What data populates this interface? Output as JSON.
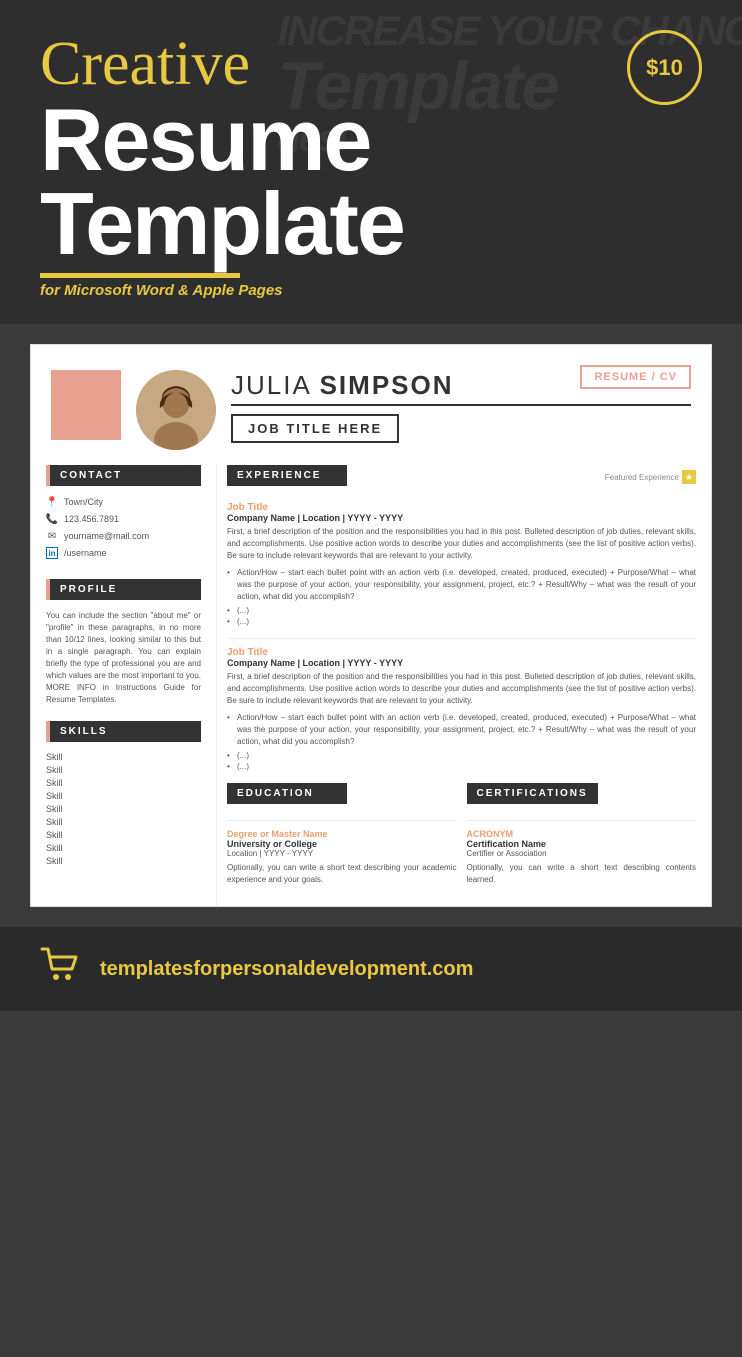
{
  "banner": {
    "creative_label": "Creative",
    "resume_label": "Resume",
    "template_label": "Template",
    "subtitle": "for Microsoft Word & Apple Pages",
    "price": "$10",
    "watermark": [
      "INCREASE YOUR CHANC",
      "Template",
      "desi"
    ]
  },
  "resume_cv_label": "RESUME / CV",
  "header": {
    "name_first": "JULIA ",
    "name_last": "SIMPSON",
    "job_title": "JOB TITLE HERE"
  },
  "contact": {
    "section_label": "CONTACT",
    "items": [
      {
        "icon": "📍",
        "text": "Town/City"
      },
      {
        "icon": "📞",
        "text": "123.456.7891"
      },
      {
        "icon": "✉",
        "text": "yourname@mail.com"
      },
      {
        "icon": "in",
        "text": "/username"
      }
    ]
  },
  "profile": {
    "section_label": "PROFILE",
    "text": "You can include the section \"about me\" or \"profile\" in these paragraphs, in no more than 10/12 lines, looking similar to this but in a single paragraph. You can explain briefly the type of professional you are and which values are the most important to you. MORE INFO in Instructions Guide for Resume Templates."
  },
  "skills": {
    "section_label": "SKILLS",
    "items": [
      "Skill",
      "Skill",
      "Skill",
      "Skill",
      "Skill",
      "Skill",
      "Skill",
      "Skill",
      "Skill"
    ]
  },
  "experience": {
    "section_label": "EXPERIENCE",
    "featured_label": "Featured Experience",
    "entries": [
      {
        "title": "Job Title",
        "company": "Company Name | Location | YYYY - YYYY",
        "desc": "First, a brief description of the position and the responsibilities you had in this post. Bulleted description of job duties, relevant skills, and accomplishments. Use positive action words to describe your duties and accomplishments (see the list of positive action verbs). Be sure to include relevant keywords that are relevant to your activity.",
        "bullet": "Action/How – start each bullet point with an action verb (i.e. developed, created, produced, executed) + Purpose/What – what was the purpose of your action, your responsibility, your assignment, project, etc.? + Result/Why – what was the result of your action, what did you accomplish?",
        "small_bullets": [
          "(...)",
          "(...)"
        ]
      },
      {
        "title": "Job Title",
        "company": "Company Name | Location | YYYY - YYYY",
        "desc": "First, a brief description of the position and the responsibilities you had in this post. Bulleted description of job duties, relevant skills, and accomplishments. Use positive action words to describe your duties and accomplishments (see the list of positive action verbs). Be sure to include relevant keywords that are relevant to your activity.",
        "bullet": "Action/How – start each bullet point with an action verb (i.e. developed, created, produced, executed) + Purpose/What – what was the purpose of your action, your responsibility, your assignment, project, etc.? + Result/Why – what was the result of your action, what did you accomplish?",
        "small_bullets": [
          "(...)",
          "(...)"
        ]
      }
    ]
  },
  "education": {
    "section_label": "EDUCATION",
    "degree": "Degree or Master Name",
    "school": "University or College",
    "location": "Location | YYYY - YYYY",
    "desc": "Optionally, you can write a short text describing your academic experience and your goals."
  },
  "certifications": {
    "section_label": "CERTIFICATIONS",
    "acronym": "ACRONYM",
    "cert_name": "Certification Name",
    "certifier": "Certifier or Association",
    "desc": "Optionally, you can write a short text describing contents learned."
  },
  "footer": {
    "url": "templatesforpersonaldevelopment.com"
  }
}
